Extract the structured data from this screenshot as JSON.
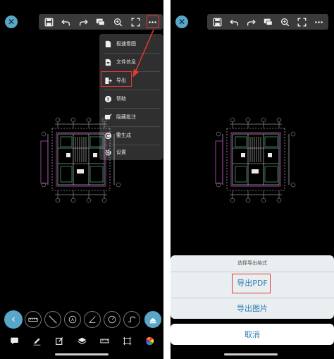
{
  "left_screen": {
    "menu": {
      "items": [
        {
          "label": "极速看图",
          "icon": "file-icon"
        },
        {
          "label": "文件信息",
          "icon": "file-info-icon"
        },
        {
          "label": "导出",
          "icon": "export-icon"
        },
        {
          "label": "帮助",
          "icon": "help-icon"
        },
        {
          "label": "隐藏批注",
          "icon": "hide-annotation-icon"
        },
        {
          "label": "重生成",
          "icon": "regenerate-icon"
        },
        {
          "label": "设置",
          "icon": "settings-icon"
        }
      ]
    }
  },
  "right_screen": {
    "sheet": {
      "title": "选择导出格式",
      "option_pdf": "导出PDF",
      "option_image": "导出图片",
      "cancel": "取消"
    }
  },
  "colors": {
    "accent": "#5aa6c8",
    "highlight": "#e53935",
    "sheet_text": "#2f7fb5"
  }
}
